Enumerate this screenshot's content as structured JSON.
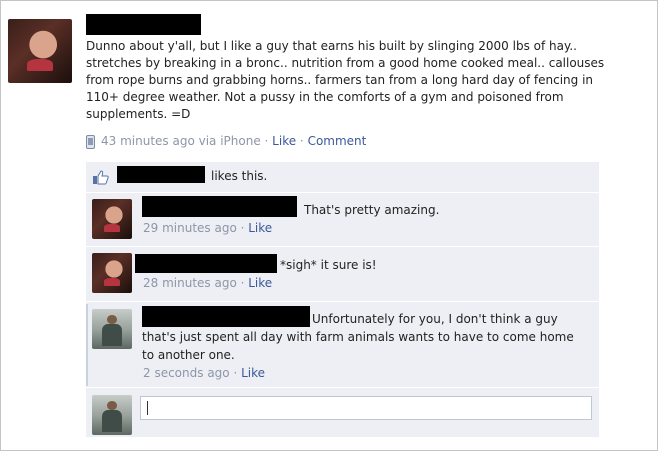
{
  "post": {
    "text": "Dunno about y'all, but I like a guy that earns his built by slinging 2000 lbs of hay.. stretches by breaking in a bronc.. nutrition from a good home cooked meal.. callouses from rope burns and grabbing horns.. farmers tan from a long hard day of fencing in 110+ degree weather. Not a pussy in the comforts of a gym and poisoned from supplements. =D",
    "time": "43 minutes ago via iPhone",
    "dot1": " · ",
    "like_label": "Like",
    "dot2": " · ",
    "comment_label": "Comment",
    "icon": "phone-icon"
  },
  "likes": {
    "text": "likes this.",
    "icon": "thumbs-up-icon"
  },
  "comments": [
    {
      "text": "That's pretty amazing.",
      "time": "29 minutes ago",
      "dot": " · ",
      "like_label": "Like",
      "avatar": "woman"
    },
    {
      "text": "*sigh* it sure is!",
      "time": "28 minutes ago",
      "dot": " · ",
      "like_label": "Like",
      "avatar": "woman"
    },
    {
      "text": "Unfortunately for you, I don't think a guy that's just spent all day with farm animals wants to have to come home to another one.",
      "time": "2 seconds ago",
      "dot": " · ",
      "like_label": "Like",
      "avatar": "man"
    }
  ],
  "reply": {
    "value": ""
  },
  "colors": {
    "link": "#3b5998",
    "meta": "#8d96a8",
    "feedback_bg": "#edeff4",
    "redaction": "#000000"
  }
}
